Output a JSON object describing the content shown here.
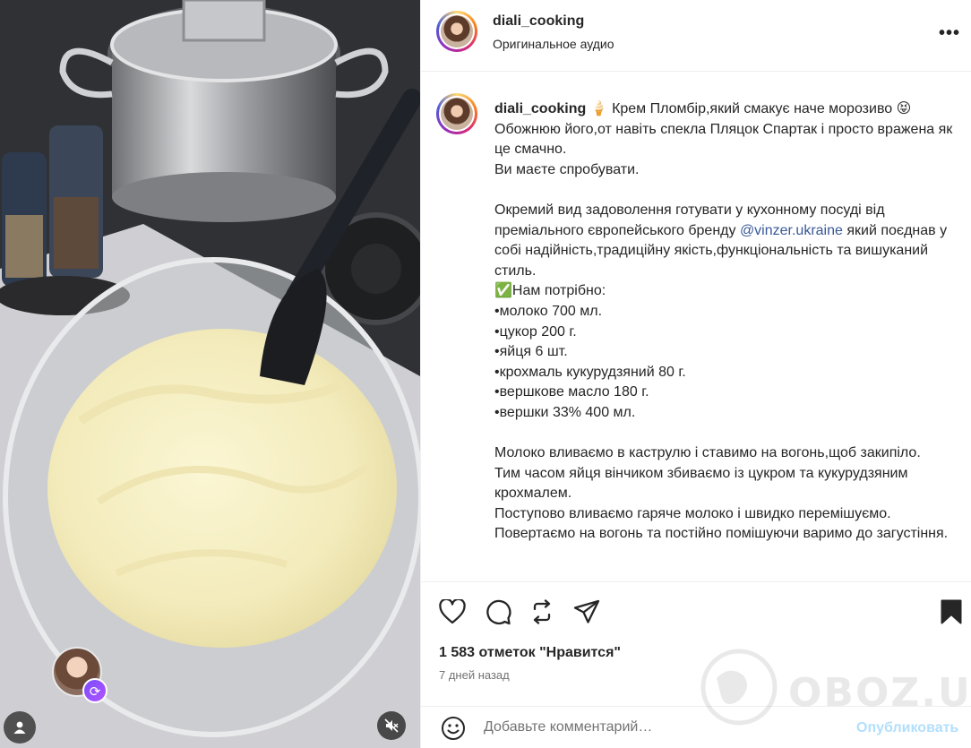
{
  "post": {
    "username": "diali_cooking",
    "audio_label": "Оригинальное аудио",
    "more_label": "•••"
  },
  "caption": {
    "username": "diali_cooking",
    "text_before_mention": " 🍦 Крем Пломбір,який смакує наче морозиво 😝\nОбожнюю його,от навіть спекла Пляцок Спартак і просто вражена як це смачно.\nВи маєте спробувати.\n\nОкремий вид задоволення готувати у кухонному посуді від преміального європейського бренду ",
    "mention": "@vinzer.ukraine",
    "text_after_mention": " який поєднав у собі надійність,традиційну якість,функціональність та вишуканий стиль.\n✅Нам потрібно:\n•молоко 700 мл.\n•цукор 200 г.\n•яйця 6 шт.\n•крохмаль кукурудзяний 80 г.\n•вершкове масло 180 г.\n•вершки 33% 400 мл.\n\nМолоко вливаємо в каструлю і ставимо на вогонь,щоб закипіло.\nТим часом яйця вінчиком збиваємо із цукром та кукурудзяним крохмалем.\nПоступово вливаємо гаряче молоко і швидко перемішуємо.\nПовертаємо на вогонь та постійно помішуючи варимо до загустіння."
  },
  "engagement": {
    "likes_label": "1 583 отметок \"Нравится\"",
    "date_label": "7 дней назад"
  },
  "comment": {
    "placeholder": "Добавьте комментарий…",
    "publish_label": "Опубликовать"
  },
  "watermark": {
    "text": "OBOZ.UA"
  },
  "icons": [
    "heart-icon",
    "comment-icon",
    "repost-icon",
    "share-icon",
    "bookmark-icon",
    "emoji-icon",
    "user-icon",
    "mute-icon",
    "remix-icon"
  ]
}
